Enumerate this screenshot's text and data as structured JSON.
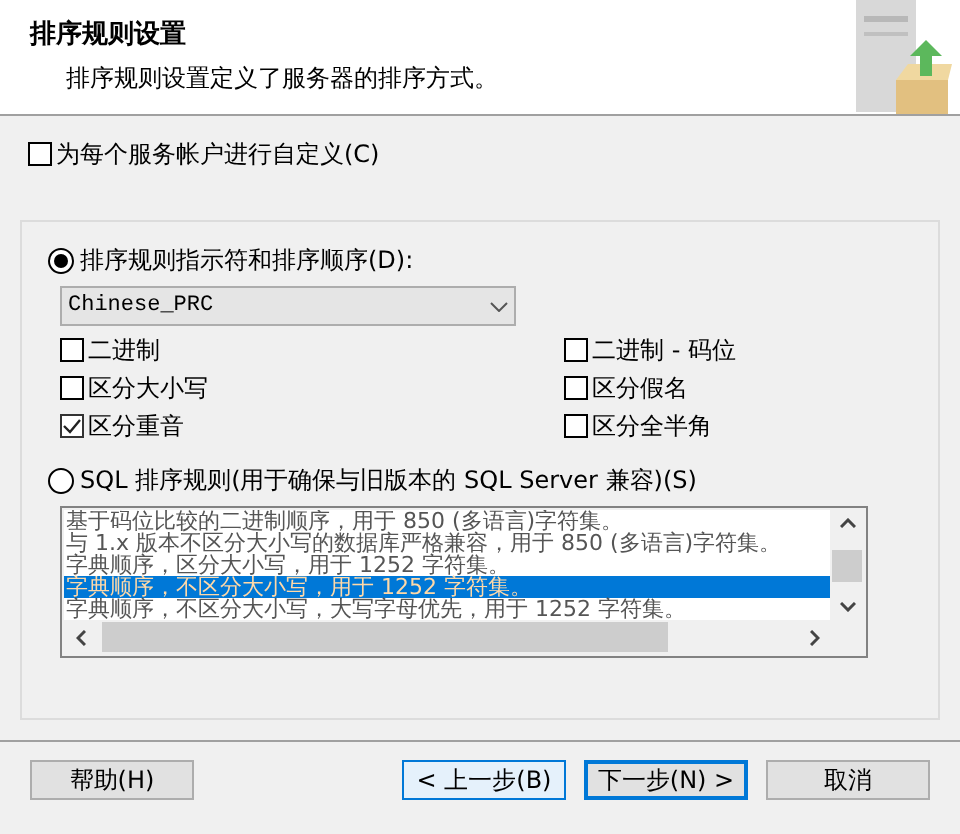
{
  "header": {
    "title": "排序规则设置",
    "subtitle": "排序规则设置定义了服务器的排序方式。"
  },
  "customize_per_account": {
    "label": "为每个服务帐户进行自定义(C)",
    "checked": false
  },
  "collation_designator": {
    "label": "排序规则指示符和排序顺序(D):",
    "selected": true,
    "dropdown": "Chinese_PRC",
    "options": [
      {
        "label": "二进制",
        "checked": false
      },
      {
        "label": "二进制 - 码位",
        "checked": false
      },
      {
        "label": "区分大小写",
        "checked": false
      },
      {
        "label": "区分假名",
        "checked": false
      },
      {
        "label": "区分重音",
        "checked": true
      },
      {
        "label": "区分全半角",
        "checked": false
      }
    ]
  },
  "sql_collation": {
    "label": "SQL 排序规则(用于确保与旧版本的 SQL Server 兼容)(S)",
    "selected": false,
    "items": [
      {
        "text": "基于码位比较的二进制顺序，用于 850 (多语言)字符集。",
        "selected": false
      },
      {
        "text": "与 1.x 版本不区分大小写的数据库严格兼容，用于 850 (多语言)字符集。",
        "selected": false
      },
      {
        "text": "字典顺序，区分大小写，用于 1252 字符集。",
        "selected": false
      },
      {
        "text": "字典顺序，不区分大小写，用于 1252 字符集。",
        "selected": true
      },
      {
        "text": "字典顺序，不区分大小写，大写字母优先，用于 1252 字符集。",
        "selected": false
      }
    ]
  },
  "buttons": [
    {
      "label": "帮助(H)",
      "kind": "plain"
    },
    {
      "label": "< 上一步(B)",
      "kind": "hover"
    },
    {
      "label": "下一步(N) >",
      "kind": "default"
    },
    {
      "label": "取消",
      "kind": "plain"
    }
  ]
}
